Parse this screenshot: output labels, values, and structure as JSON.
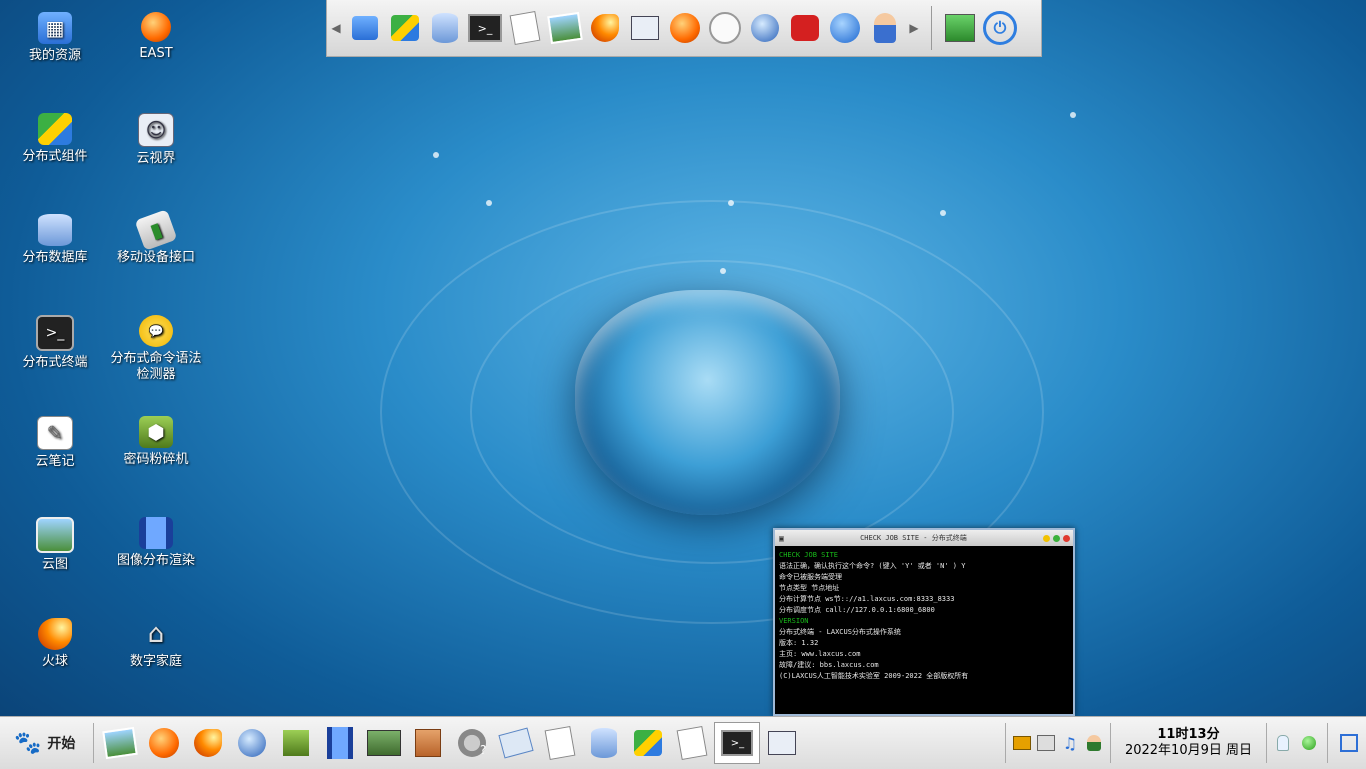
{
  "desktop": {
    "icons": [
      {
        "label": "我的资源"
      },
      {
        "label": "EAST"
      },
      {
        "label": "分布式组件"
      },
      {
        "label": "云视界"
      },
      {
        "label": "分布数据库"
      },
      {
        "label": "移动设备接口"
      },
      {
        "label": "分布式终端"
      },
      {
        "label": "分布式命令语法检测器"
      },
      {
        "label": "云笔记"
      },
      {
        "label": "密码粉碎机"
      },
      {
        "label": "云图"
      },
      {
        "label": "图像分布渲染"
      },
      {
        "label": "火球"
      },
      {
        "label": "数字家庭"
      }
    ]
  },
  "terminal": {
    "title": "CHECK JOB SITE - 分布式终端",
    "lines": [
      {
        "text": "CHECK JOB SITE"
      },
      {
        "text": "语法正确，确认执行这个命令? (键入 'Y' 或者 'N' ) Y"
      },
      {
        "text": "命令已被服务端受理"
      },
      {
        "text": "节点类型  节点地址"
      },
      {
        "text": "分布计算节点  ws节:://a1.laxcus.com:8333_8333"
      },
      {
        "text": "分布调度节点  call://127.0.0.1:6800_6800"
      },
      {
        "text": "VERSION"
      },
      {
        "text": "分布式终端 - LAXCUS分布式操作系统"
      },
      {
        "text": "版本: 1.32"
      },
      {
        "text": "主页: www.laxcus.com"
      },
      {
        "text": "故障/建议: bbs.laxcus.com"
      },
      {
        "text": "(C)LAXCUS人工智能技术实验室 2009-2022 全部版权所有"
      }
    ]
  },
  "taskbar": {
    "start_label": "开始",
    "clock": {
      "time": "11时13分",
      "date": "2022年10月9日 周日"
    }
  },
  "colors": {
    "terminal_green": "#18b81a",
    "taskbar_bg": "#e6e6e6"
  }
}
